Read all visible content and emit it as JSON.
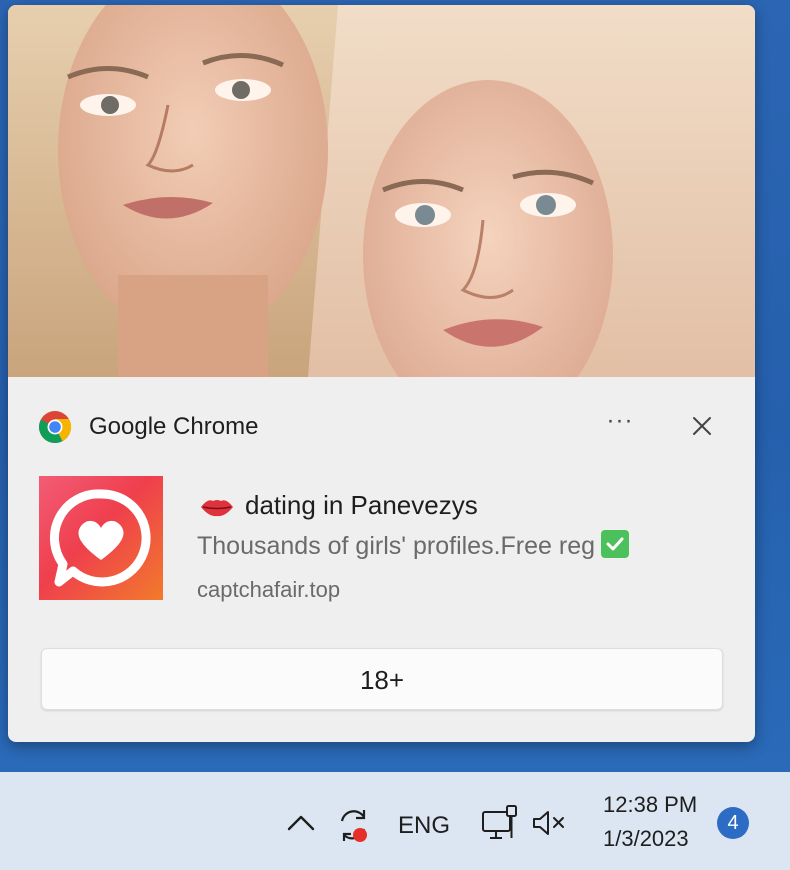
{
  "notification": {
    "app_name": "Google Chrome",
    "more_label": "···",
    "title_emoji": "lips-icon",
    "title": "dating in Panevezys",
    "body": "Thousands of girls' profiles.Free reg",
    "body_emoji": "check-mark-button-icon",
    "source": "captchafair.top",
    "action_label": "18+"
  },
  "taskbar": {
    "language": "ENG",
    "time": "12:38 PM",
    "date": "1/3/2023",
    "notification_count": "4"
  },
  "colors": {
    "desktop": "#2a63b0",
    "toast_bg": "#efefef",
    "taskbar_bg": "#dce6f2",
    "badge": "#2c6cc4",
    "logo_gradient_start": "#f25c77",
    "logo_gradient_end": "#f27a2c",
    "check": "#4cc05a",
    "record_dot": "#e5302a"
  }
}
